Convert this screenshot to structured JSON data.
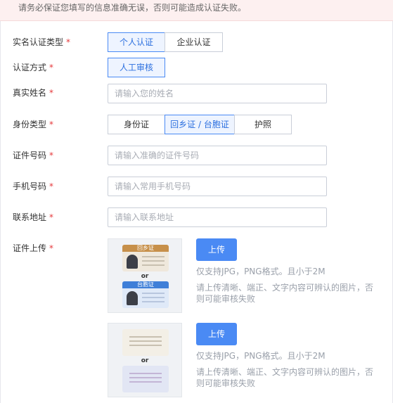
{
  "notice": "请务必保证您填写的信息准确无误，否则可能造成认证失败。",
  "required_mark": "*",
  "auth_type": {
    "label": "实名认证类型",
    "options": [
      "个人认证",
      "企业认证"
    ],
    "selected": "个人认证"
  },
  "auth_method": {
    "label": "认证方式",
    "options": [
      "人工审核"
    ],
    "selected": "人工审核"
  },
  "real_name": {
    "label": "真实姓名",
    "placeholder": "请输入您的姓名",
    "value": ""
  },
  "id_type": {
    "label": "身份类型",
    "options": [
      "身份证",
      "回乡证 / 台胞证",
      "护照"
    ],
    "selected": "回乡证 / 台胞证"
  },
  "id_number": {
    "label": "证件号码",
    "placeholder": "请输入准确的证件号码",
    "value": ""
  },
  "phone": {
    "label": "手机号码",
    "placeholder": "请输入常用手机号码",
    "value": ""
  },
  "address": {
    "label": "联系地址",
    "placeholder": "请输入联系地址",
    "value": ""
  },
  "upload": {
    "label": "证件上传",
    "slots": [
      {
        "sample_top": "回乡证",
        "sample_or": "or",
        "sample_bottom": "台胞证",
        "button": "上传",
        "format_hint": "仅支持JPG，PNG格式。且小于2M",
        "quality_hint": "请上传清晰、端正、文字内容可辨认的图片，否则可能审核失败"
      },
      {
        "sample_or": "or",
        "button": "上传",
        "format_hint": "仅支持JPG，PNG格式。且小于2M",
        "quality_hint": "请上传清晰、端正、文字内容可辨认的图片，否则可能审核失败"
      }
    ]
  },
  "colors": {
    "accent": "#4a8af4",
    "required": "#e5383b",
    "notice_bg": "#fdf0f0",
    "card_top": "#c7904a",
    "card_bottom": "#3f7fd8"
  }
}
